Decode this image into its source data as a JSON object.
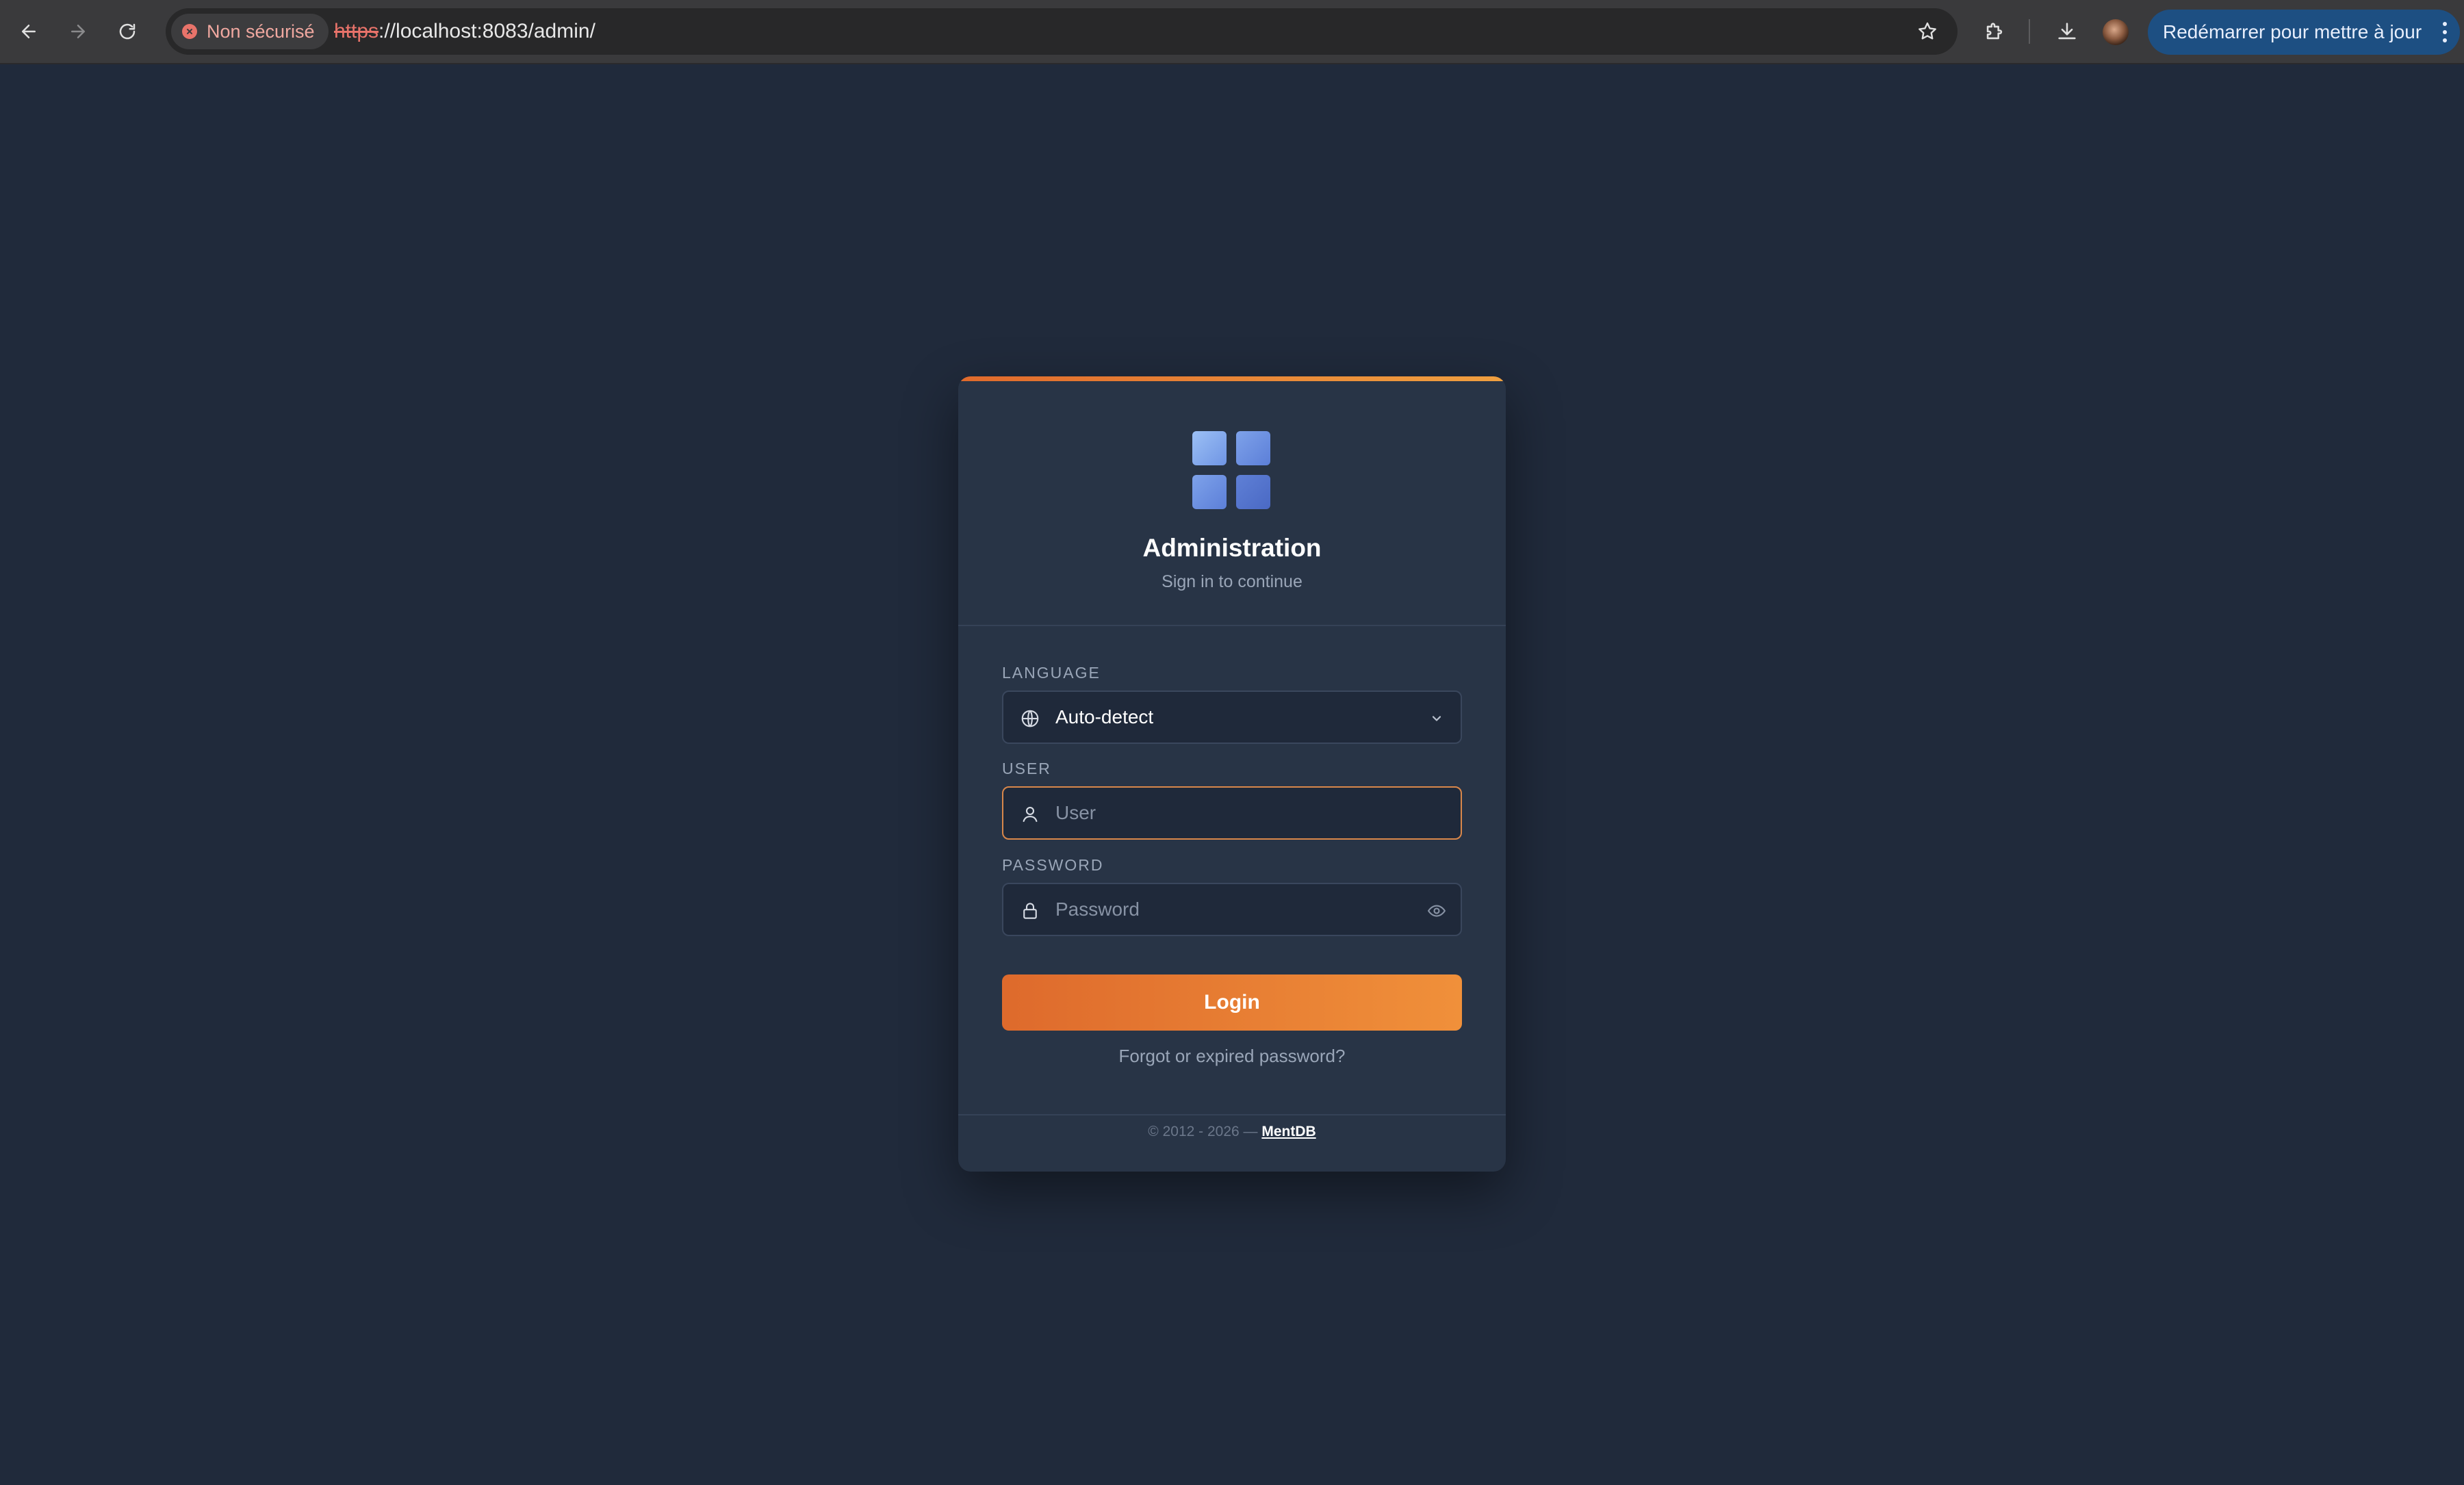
{
  "browser": {
    "security_label": "Non sécurisé",
    "url_scheme": "https",
    "url_rest": "://localhost:8083/admin/",
    "update_button_label": "Redémarrer pour mettre à jour"
  },
  "login": {
    "title": "Administration",
    "subtitle": "Sign in to continue",
    "language": {
      "label": "LANGUAGE",
      "selected": "Auto-detect"
    },
    "user": {
      "label": "USER",
      "placeholder": "User"
    },
    "password": {
      "label": "PASSWORD",
      "placeholder": "Password"
    },
    "login_button": "Login",
    "forgot_link": "Forgot or expired password?",
    "footer": {
      "copyright": "© 2012 - 2026 —",
      "brand": "MentDB"
    }
  },
  "colors": {
    "page_background": "#202a3b",
    "card_background": "#283446",
    "accent_orange": "#e8782f",
    "logo_blue": "#6f95e4",
    "update_button": "#1d4f82"
  },
  "icons": {
    "back": "arrow-left-icon",
    "forward": "arrow-right-icon",
    "reload": "reload-icon",
    "security": "x-circle-icon",
    "bookmark": "star-icon",
    "extensions": "puzzle-icon",
    "downloads": "download-icon",
    "menu": "kebab-menu-icon",
    "logo": "grid-logo-icon",
    "language": "globe-icon",
    "dropdown": "chevron-down-icon",
    "user": "user-icon",
    "password": "lock-icon",
    "show_password": "eye-icon"
  }
}
